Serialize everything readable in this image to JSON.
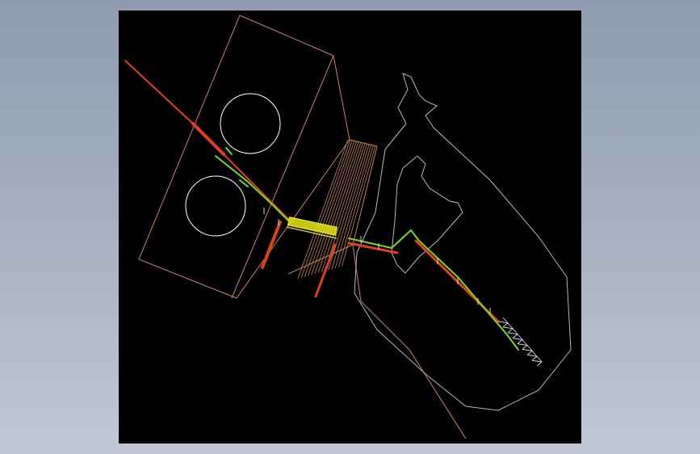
{
  "drawing": {
    "background": "#000000",
    "window_background": "#a4adbe",
    "layer_colors": {
      "structure_outline": "#c8865a",
      "terrain_contour": "#b8b8b8",
      "tank": "#ffffff",
      "pipeline_primary": "#e0401a",
      "pipeline_secondary": "#7cd81e",
      "equipment": "#e8e81a",
      "truss": "#d8d8d8",
      "annotation": "#cfe8a0"
    }
  }
}
